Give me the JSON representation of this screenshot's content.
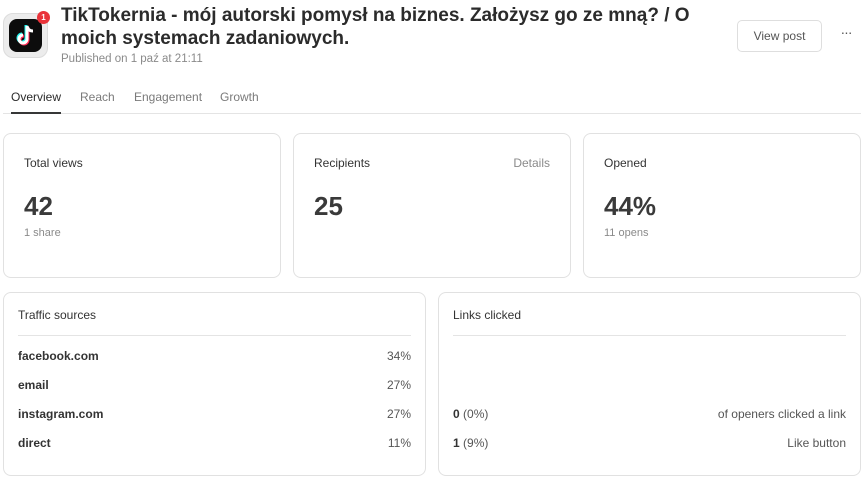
{
  "header": {
    "app_icon": "tiktok-icon",
    "badge_count": "1",
    "title": "TikTokernia - mój autorski pomysł na biznes. Założysz go ze mną? / O moich systemach zadaniowych.",
    "published": "Published on 1 paź at 21:11",
    "view_post_label": "View post",
    "more_label": "···"
  },
  "tabs": [
    {
      "label": "Overview",
      "active": true
    },
    {
      "label": "Reach",
      "active": false
    },
    {
      "label": "Engagement",
      "active": false
    },
    {
      "label": "Growth",
      "active": false
    }
  ],
  "stats": [
    {
      "label": "Total views",
      "value": "42",
      "sub": "1 share"
    },
    {
      "label": "Recipients",
      "value": "25",
      "action": "Details"
    },
    {
      "label": "Opened",
      "value": "44%",
      "sub": "11 opens"
    }
  ],
  "traffic": {
    "title": "Traffic sources",
    "rows": [
      {
        "source": "facebook.com",
        "percent": "34%"
      },
      {
        "source": "email",
        "percent": "27%"
      },
      {
        "source": "instagram.com",
        "percent": "27%"
      },
      {
        "source": "direct",
        "percent": "11%"
      }
    ]
  },
  "links": {
    "title": "Links clicked",
    "rows": [
      {
        "count": "0",
        "pct": " (0%)",
        "label": "of openers clicked a link"
      },
      {
        "count": "1",
        "pct": " (9%)",
        "label": "Like button"
      }
    ]
  }
}
